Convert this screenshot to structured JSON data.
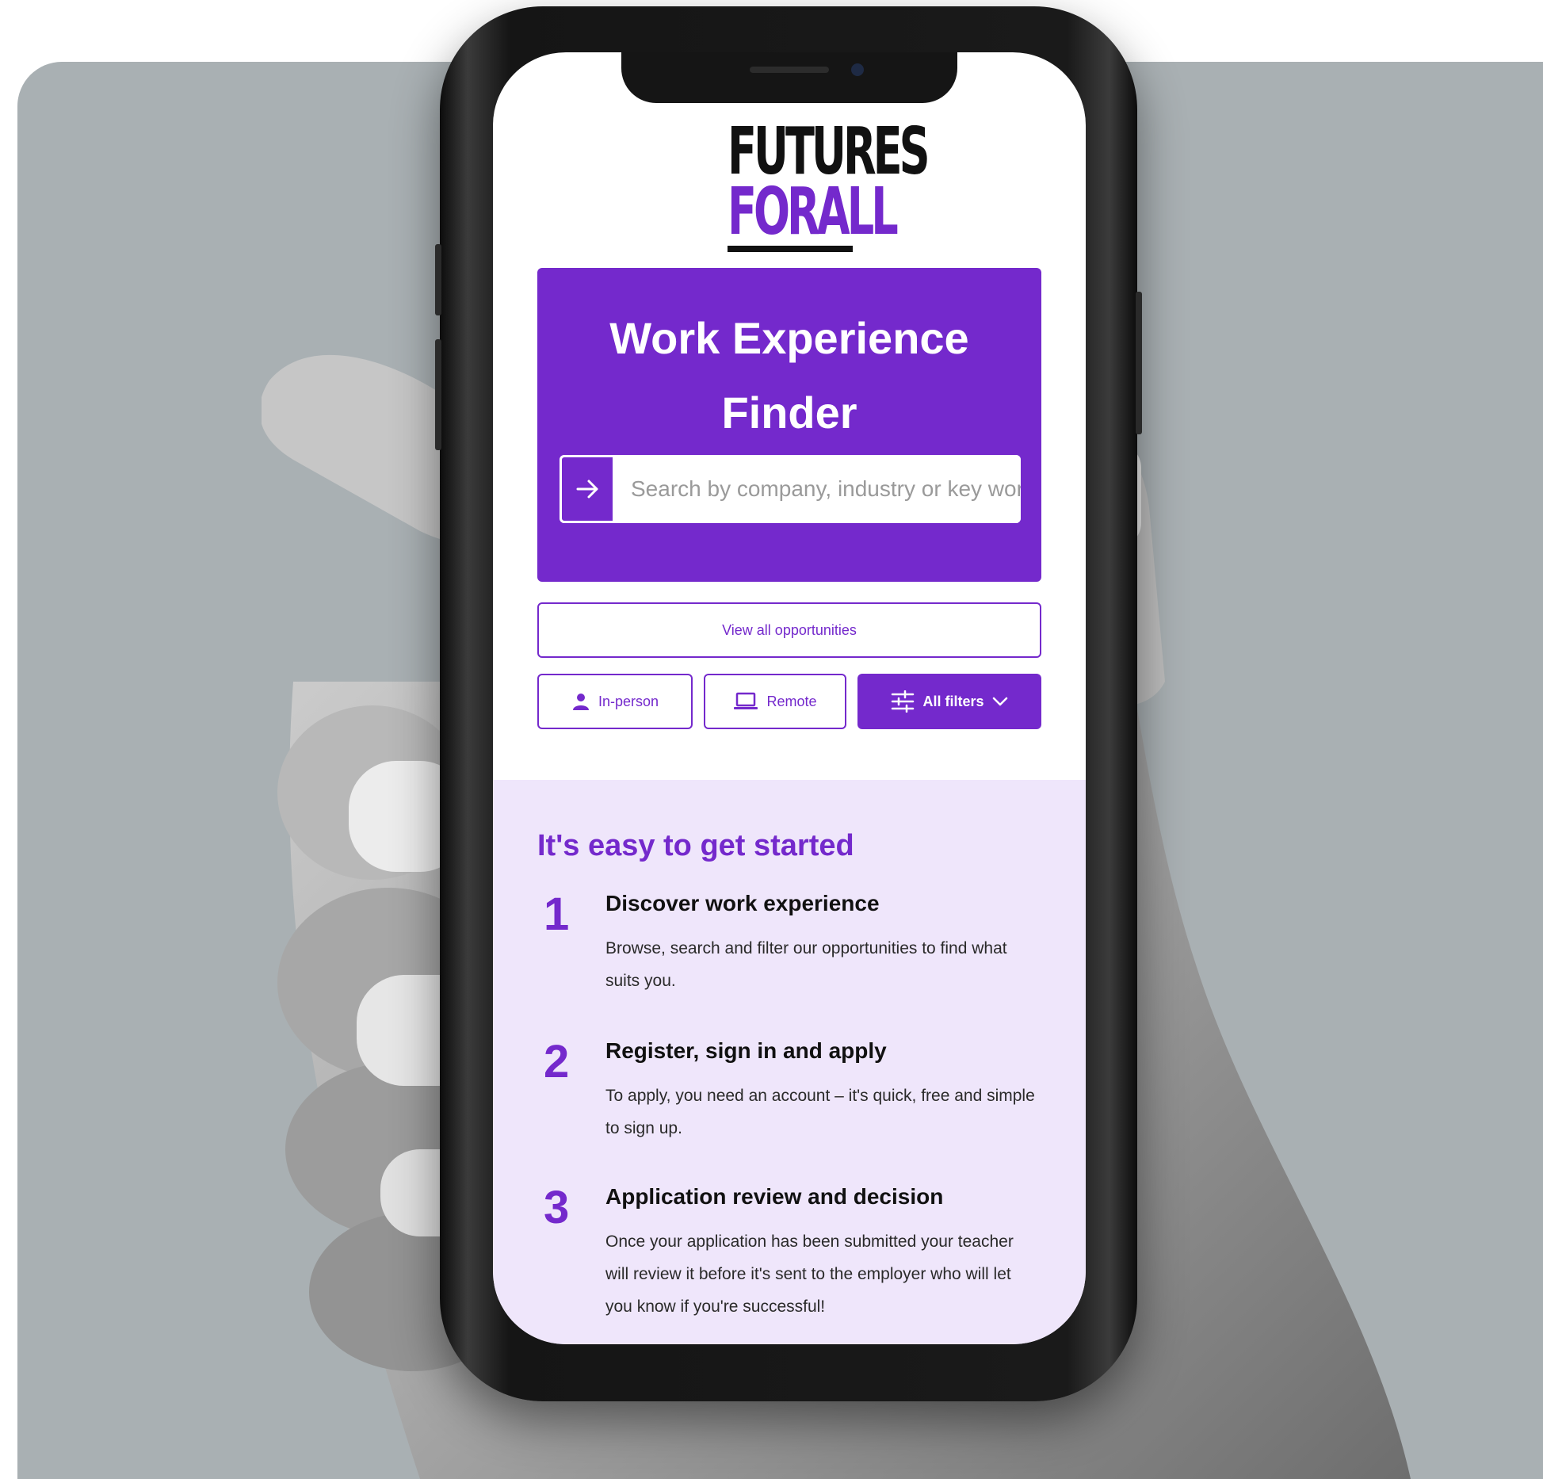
{
  "logo": {
    "line1": "FUTURES",
    "line2": "FORALL"
  },
  "hero": {
    "title_line1": "Work Experience",
    "title_line2": "Finder",
    "search_placeholder": "Search by company, industry or key word"
  },
  "actions": {
    "view_all": "View all opportunities",
    "in_person": "In-person",
    "remote": "Remote",
    "all_filters": "All filters"
  },
  "started": {
    "title": "It's easy to get started",
    "steps": [
      {
        "num": "1",
        "title": "Discover work experience",
        "desc": "Browse, search and filter our opportunities to find what suits you."
      },
      {
        "num": "2",
        "title": "Register, sign in and apply",
        "desc": "To apply, you need an account – it's quick, free and simple to sign up."
      },
      {
        "num": "3",
        "title": "Application review and decision",
        "desc": "Once your application has been submitted your teacher will review it before it's sent to the employer who will let you know if you're successful!"
      }
    ]
  },
  "colors": {
    "brand_purple": "#7429cc",
    "light_lilac": "#efe6fb",
    "backdrop": "#a9b0b3"
  }
}
